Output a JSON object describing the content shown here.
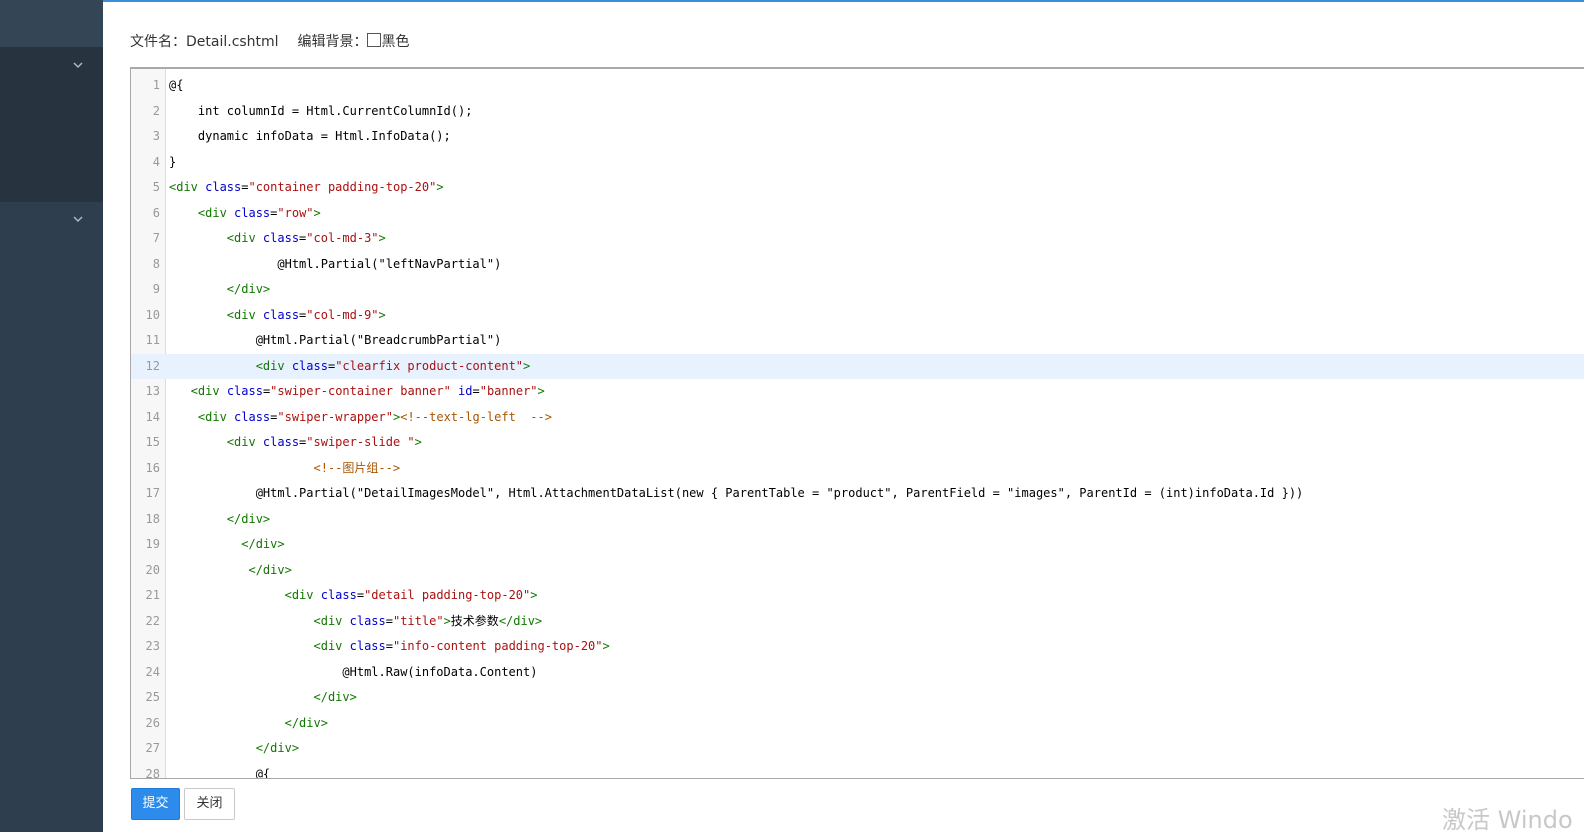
{
  "header": {
    "filename_label": "文件名：",
    "filename": "Detail.cshtml",
    "bg_label": "编辑背景：",
    "bg_option": "黑色",
    "bg_checked": false
  },
  "editor": {
    "active_line": 12,
    "lines": [
      {
        "n": "1",
        "t": [
          {
            "c": "",
            "s": "@{"
          }
        ]
      },
      {
        "n": "2",
        "t": [
          {
            "c": "",
            "s": "    int columnId = Html.CurrentColumnId();"
          }
        ]
      },
      {
        "n": "3",
        "t": [
          {
            "c": "",
            "s": "    dynamic infoData = Html.InfoData();"
          }
        ]
      },
      {
        "n": "4",
        "t": [
          {
            "c": "",
            "s": "}"
          }
        ]
      },
      {
        "n": "5",
        "t": [
          {
            "c": "tag",
            "s": "<div "
          },
          {
            "c": "attr",
            "s": "class"
          },
          {
            "c": "",
            "s": "="
          },
          {
            "c": "str",
            "s": "\"container padding-top-20\""
          },
          {
            "c": "tag",
            "s": ">"
          }
        ]
      },
      {
        "n": "6",
        "t": [
          {
            "c": "",
            "s": "    "
          },
          {
            "c": "tag",
            "s": "<div "
          },
          {
            "c": "attr",
            "s": "class"
          },
          {
            "c": "",
            "s": "="
          },
          {
            "c": "str",
            "s": "\"row\""
          },
          {
            "c": "tag",
            "s": ">"
          }
        ]
      },
      {
        "n": "7",
        "t": [
          {
            "c": "",
            "s": "        "
          },
          {
            "c": "tag",
            "s": "<div "
          },
          {
            "c": "attr",
            "s": "class"
          },
          {
            "c": "",
            "s": "="
          },
          {
            "c": "str",
            "s": "\"col-md-3\""
          },
          {
            "c": "tag",
            "s": ">"
          }
        ]
      },
      {
        "n": "8",
        "t": [
          {
            "c": "",
            "s": "               @Html.Partial(\"leftNavPartial\")"
          }
        ]
      },
      {
        "n": "9",
        "t": [
          {
            "c": "",
            "s": "        "
          },
          {
            "c": "tag",
            "s": "</div>"
          }
        ]
      },
      {
        "n": "10",
        "t": [
          {
            "c": "",
            "s": "        "
          },
          {
            "c": "tag",
            "s": "<div "
          },
          {
            "c": "attr",
            "s": "class"
          },
          {
            "c": "",
            "s": "="
          },
          {
            "c": "str",
            "s": "\"col-md-9\""
          },
          {
            "c": "tag",
            "s": ">"
          }
        ]
      },
      {
        "n": "11",
        "t": [
          {
            "c": "",
            "s": "            @Html.Partial(\"BreadcrumbPartial\")"
          }
        ]
      },
      {
        "n": "12",
        "t": [
          {
            "c": "",
            "s": "            "
          },
          {
            "c": "tag",
            "s": "<div "
          },
          {
            "c": "attr",
            "s": "class"
          },
          {
            "c": "",
            "s": "="
          },
          {
            "c": "str",
            "s": "\"clearfix product-content\""
          },
          {
            "c": "tag",
            "s": ">"
          }
        ]
      },
      {
        "n": "13",
        "t": [
          {
            "c": "",
            "s": "   "
          },
          {
            "c": "tag",
            "s": "<div "
          },
          {
            "c": "attr",
            "s": "class"
          },
          {
            "c": "",
            "s": "="
          },
          {
            "c": "str",
            "s": "\"swiper-container banner\""
          },
          {
            "c": "",
            "s": " "
          },
          {
            "c": "attr",
            "s": "id"
          },
          {
            "c": "",
            "s": "="
          },
          {
            "c": "str",
            "s": "\"banner\""
          },
          {
            "c": "tag",
            "s": ">"
          }
        ]
      },
      {
        "n": "14",
        "t": [
          {
            "c": "",
            "s": "    "
          },
          {
            "c": "tag",
            "s": "<div "
          },
          {
            "c": "attr",
            "s": "class"
          },
          {
            "c": "",
            "s": "="
          },
          {
            "c": "str",
            "s": "\"swiper-wrapper\""
          },
          {
            "c": "tag",
            "s": ">"
          },
          {
            "c": "com",
            "s": "<!--text-lg-left  -->"
          }
        ]
      },
      {
        "n": "15",
        "t": [
          {
            "c": "",
            "s": "        "
          },
          {
            "c": "tag",
            "s": "<div "
          },
          {
            "c": "attr",
            "s": "class"
          },
          {
            "c": "",
            "s": "="
          },
          {
            "c": "str",
            "s": "\"swiper-slide \""
          },
          {
            "c": "tag",
            "s": ">"
          }
        ]
      },
      {
        "n": "16",
        "t": [
          {
            "c": "",
            "s": "                    "
          },
          {
            "c": "com",
            "s": "<!--图片组-->"
          }
        ]
      },
      {
        "n": "17",
        "t": [
          {
            "c": "",
            "s": "            @Html.Partial(\"DetailImagesModel\", Html.AttachmentDataList(new { ParentTable = \"product\", ParentField = \"images\", ParentId = (int)infoData.Id }))"
          }
        ]
      },
      {
        "n": "18",
        "t": [
          {
            "c": "",
            "s": "        "
          },
          {
            "c": "tag",
            "s": "</div>"
          }
        ]
      },
      {
        "n": "19",
        "t": [
          {
            "c": "",
            "s": "          "
          },
          {
            "c": "tag",
            "s": "</div>"
          }
        ]
      },
      {
        "n": "20",
        "t": [
          {
            "c": "",
            "s": "           "
          },
          {
            "c": "tag",
            "s": "</div>"
          }
        ]
      },
      {
        "n": "21",
        "t": [
          {
            "c": "",
            "s": "                "
          },
          {
            "c": "tag",
            "s": "<div "
          },
          {
            "c": "attr",
            "s": "class"
          },
          {
            "c": "",
            "s": "="
          },
          {
            "c": "str",
            "s": "\"detail padding-top-20\""
          },
          {
            "c": "tag",
            "s": ">"
          }
        ]
      },
      {
        "n": "22",
        "t": [
          {
            "c": "",
            "s": "                    "
          },
          {
            "c": "tag",
            "s": "<div "
          },
          {
            "c": "attr",
            "s": "class"
          },
          {
            "c": "",
            "s": "="
          },
          {
            "c": "str",
            "s": "\"title\""
          },
          {
            "c": "tag",
            "s": ">"
          },
          {
            "c": "",
            "s": "技术参数"
          },
          {
            "c": "tag",
            "s": "</div>"
          }
        ]
      },
      {
        "n": "23",
        "t": [
          {
            "c": "",
            "s": "                    "
          },
          {
            "c": "tag",
            "s": "<div "
          },
          {
            "c": "attr",
            "s": "class"
          },
          {
            "c": "",
            "s": "="
          },
          {
            "c": "str",
            "s": "\"info-content padding-top-20\""
          },
          {
            "c": "tag",
            "s": ">"
          }
        ]
      },
      {
        "n": "24",
        "t": [
          {
            "c": "",
            "s": "                        @Html.Raw(infoData.Content)"
          }
        ]
      },
      {
        "n": "25",
        "t": [
          {
            "c": "",
            "s": "                    "
          },
          {
            "c": "tag",
            "s": "</div>"
          }
        ]
      },
      {
        "n": "26",
        "t": [
          {
            "c": "",
            "s": "                "
          },
          {
            "c": "tag",
            "s": "</div>"
          }
        ]
      },
      {
        "n": "27",
        "t": [
          {
            "c": "",
            "s": "            "
          },
          {
            "c": "tag",
            "s": "</div>"
          }
        ]
      },
      {
        "n": "28",
        "t": [
          {
            "c": "",
            "s": "            @{"
          }
        ]
      }
    ]
  },
  "buttons": {
    "submit": "提交",
    "close": "关闭"
  },
  "watermark": "激活 Windo",
  "sidebar": {
    "items": [
      {
        "icon": "chevron-down-icon"
      },
      {
        "icon": "chevron-down-icon"
      }
    ]
  },
  "colors": {
    "accent": "#2d8ceb",
    "sidebar": "#2f3e4e"
  }
}
